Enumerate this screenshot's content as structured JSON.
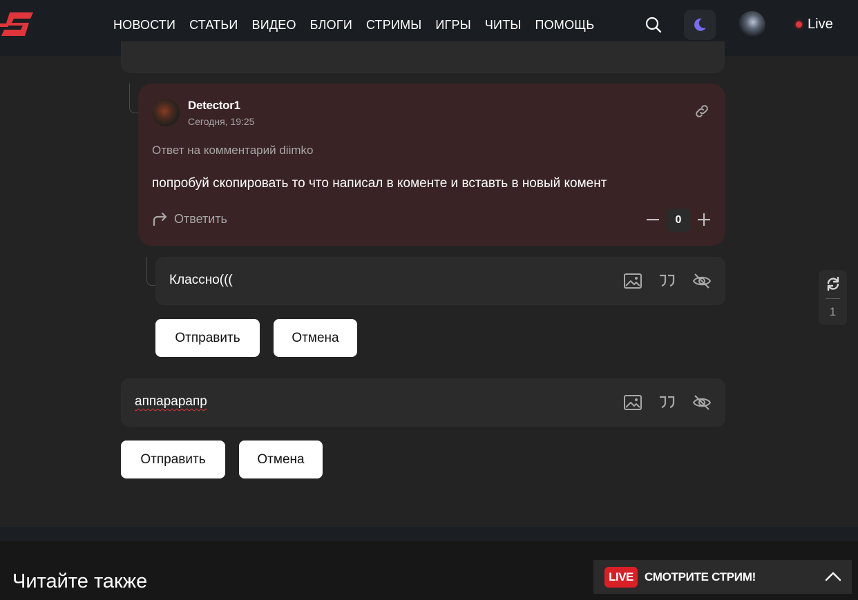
{
  "header": {
    "nav": [
      "НОВОСТИ",
      "СТАТЬИ",
      "ВИДЕО",
      "БЛОГИ",
      "СТРИМЫ",
      "ИГРЫ",
      "ЧИТЫ",
      "ПОМОЩЬ"
    ],
    "live_label": "Live",
    "colors": {
      "brand": "#e0353a",
      "moon": "#7a6cf0"
    }
  },
  "comment": {
    "author": "Detector1",
    "date": "Сегодня, 19:25",
    "reply_to": "Ответ на комментарий diimko",
    "text": "попробуй скопировать то что написал в коменте и вставть в новый комент",
    "reply_label": "Ответить",
    "votes": "0"
  },
  "reply_form": {
    "value": "Классно(((",
    "submit_label": "Отправить",
    "cancel_label": "Отмена"
  },
  "main_form": {
    "value": "аппарарапр",
    "submit_label": "Отправить",
    "cancel_label": "Отмена"
  },
  "side_widget": {
    "count": "1"
  },
  "footer": {
    "read_also": "Читайте также",
    "live_badge": "LIVE",
    "live_cta": "СМОТРИТЕ СТРИМ!"
  }
}
